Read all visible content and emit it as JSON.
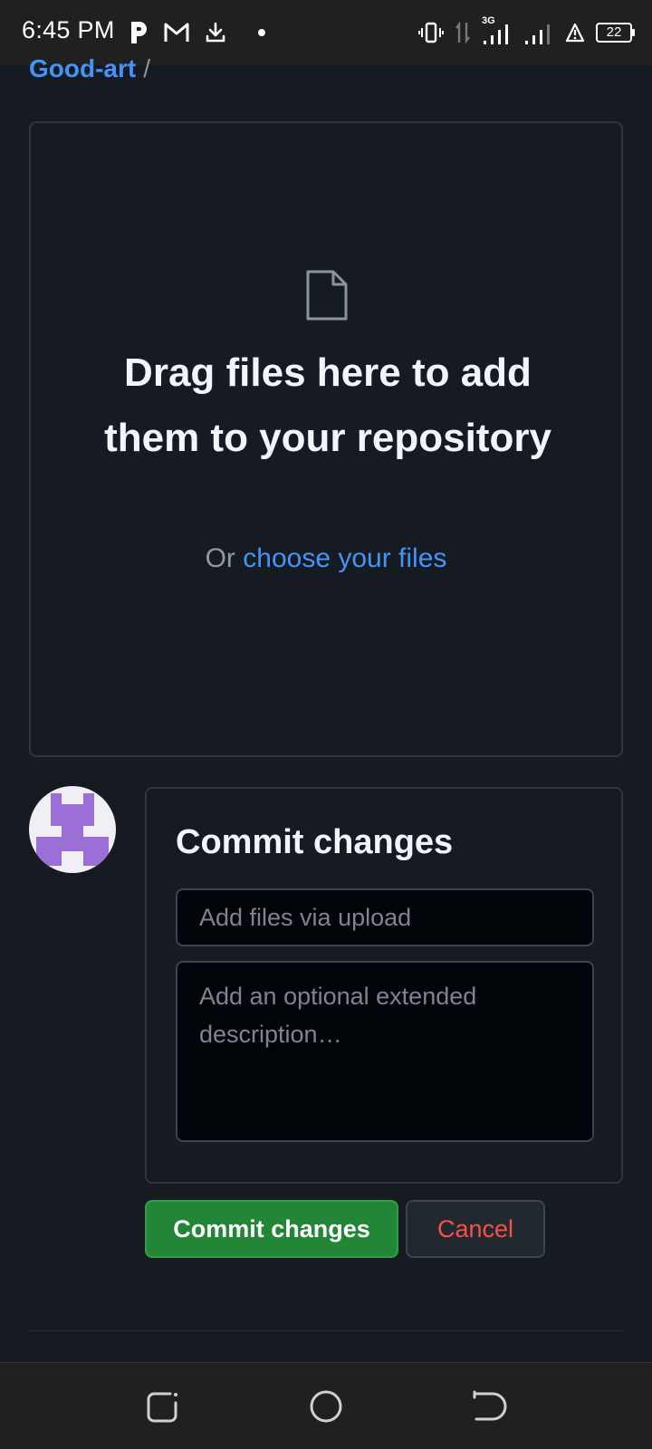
{
  "status_bar": {
    "time": "6:45 PM",
    "network_label": "3G",
    "battery_level": "22",
    "left_icons": [
      "parking-app-icon",
      "gmail-icon",
      "download-icon",
      "notification-dot-icon"
    ],
    "right_icons": [
      "vibrate-icon",
      "data-arrows-icon",
      "signal-icon",
      "signal-icon",
      "alert-icon",
      "battery-icon"
    ]
  },
  "breadcrumb": {
    "repo": "Good-art",
    "separator": "/"
  },
  "dropzone": {
    "title": "Drag files here to add them to your repository",
    "or_text": "Or",
    "choose_link": "choose your files"
  },
  "commit": {
    "title": "Commit changes",
    "summary_placeholder": "Add files via upload",
    "summary_value": "",
    "description_placeholder": "Add an optional extended description…",
    "description_value": ""
  },
  "buttons": {
    "commit_label": "Commit changes",
    "cancel_label": "Cancel"
  },
  "colors": {
    "link": "#4493f8",
    "commit_button": "#238636",
    "cancel_text": "#f85149",
    "avatar_accent": "#9b6fd6"
  },
  "nav_bar": {
    "buttons": [
      "recent-apps-icon",
      "home-icon",
      "back-icon"
    ]
  }
}
